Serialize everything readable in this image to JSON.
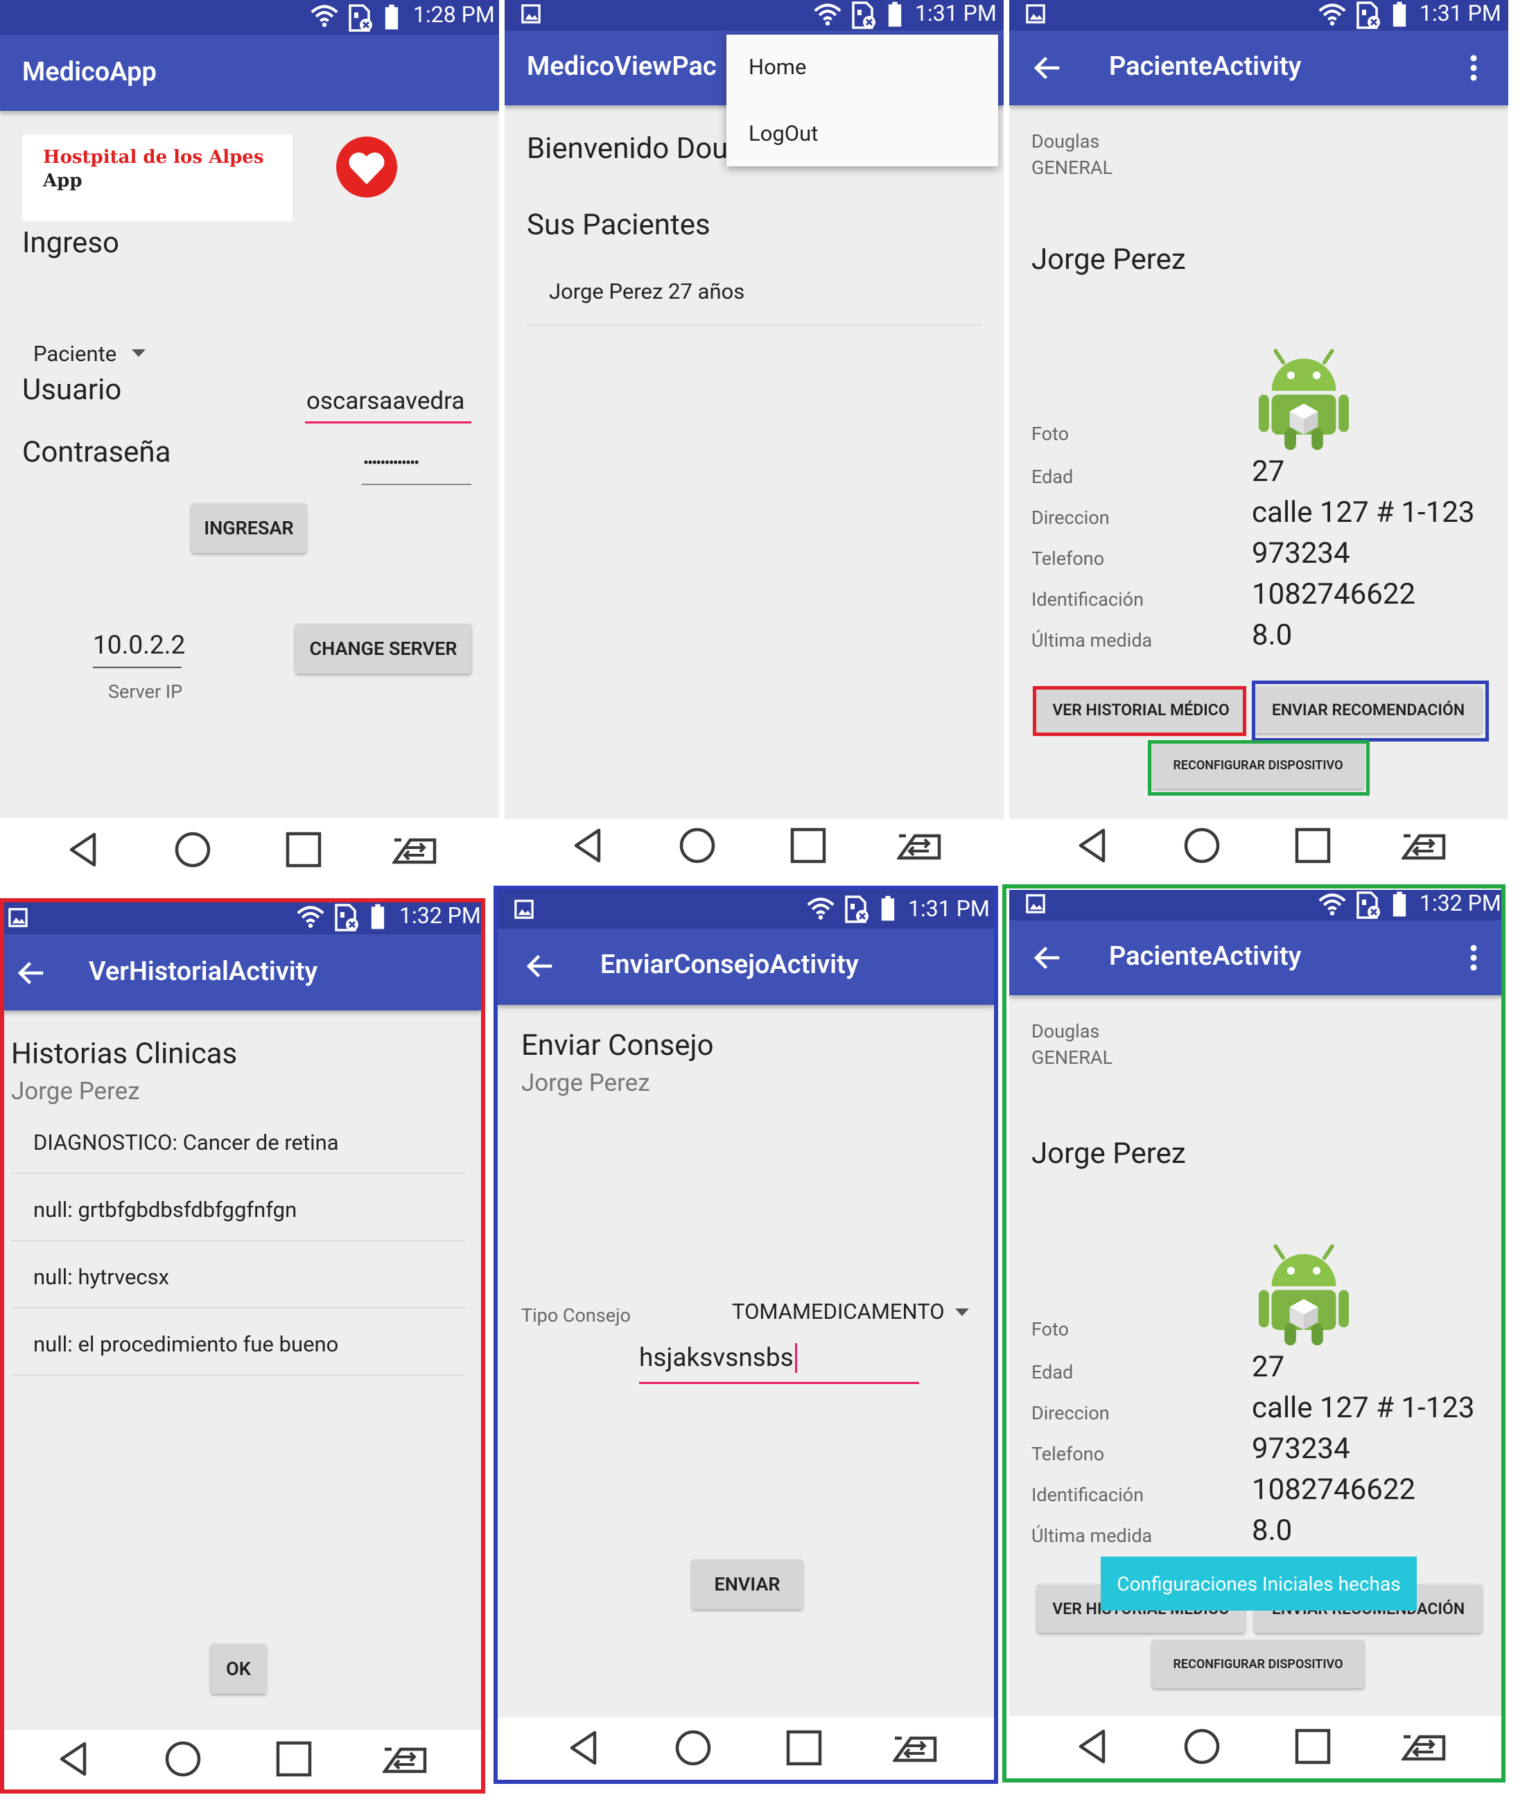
{
  "colors": {
    "primary": "#3f51b5",
    "primary_dark": "#303f9f",
    "accent": "#ff4081",
    "frame_red": "#e0202a",
    "frame_blue": "#2e3fb8",
    "frame_green": "#21a945",
    "toast": "#26c6da",
    "heart": "#e52421"
  },
  "s1": {
    "time": "1:28 PM",
    "title": "MedicoApp",
    "logo_line1": "Hostpital de los Alpes",
    "logo_line2": "App",
    "heading": "Ingreso",
    "role": "Paciente",
    "usuario_label": "Usuario",
    "usuario_value": "oscarsaavedra",
    "password_label": "Contraseña",
    "password_value": "•••••••••••••",
    "login_button": "INGRESAR",
    "server_ip": "10.0.2.2",
    "server_ip_label": "Server IP",
    "change_server_button": "CHANGE SERVER"
  },
  "s2": {
    "time": "1:31 PM",
    "title": "MedicoViewPac",
    "welcome": "Bienvenido Dou",
    "patients_heading": "Sus Pacientes",
    "patients": [
      "Jorge Perez 27 años"
    ],
    "menu": [
      "Home",
      "LogOut"
    ]
  },
  "s3": {
    "time": "1:31 PM",
    "title": "PacienteActivity",
    "doctor": "Douglas",
    "specialty": "GENERAL",
    "patient_name": "Jorge Perez",
    "labels": {
      "foto": "Foto",
      "edad": "Edad",
      "direccion": "Direccion",
      "telefono": "Telefono",
      "identificacion": "Identificación",
      "ultima": "Última medida"
    },
    "values": {
      "edad": "27",
      "direccion": "calle 127 # 1-123",
      "telefono": "973234",
      "identificacion": "1082746622",
      "ultima": "8.0"
    },
    "btn_historial": "VER HISTORIAL MÉDICO",
    "btn_recomendacion": "ENVIAR RECOMENDACIÓN",
    "btn_reconfigurar": "RECONFIGURAR DISPOSITIVO"
  },
  "s4": {
    "time": "1:32 PM",
    "title": "VerHistorialActivity",
    "heading": "Historias Clinicas",
    "patient": "Jorge Perez",
    "entries": [
      "DIAGNOSTICO: Cancer de retina",
      "null: grtbfgbdbsfdbfggfnfgn",
      "null: hytrvecsx",
      "null: el procedimiento fue bueno"
    ],
    "ok_button": "OK"
  },
  "s5": {
    "time": "1:31 PM",
    "title": "EnviarConsejoActivity",
    "heading": "Enviar Consejo",
    "patient": "Jorge Perez",
    "tipo_label": "Tipo Consejo",
    "tipo_value": "TOMAMEDICAMENTO",
    "message_value": "hsjaksvsnsbs",
    "send_button": "ENVIAR"
  },
  "s6": {
    "time": "1:32 PM",
    "title": "PacienteActivity",
    "doctor": "Douglas",
    "specialty": "GENERAL",
    "patient_name": "Jorge Perez",
    "labels": {
      "foto": "Foto",
      "edad": "Edad",
      "direccion": "Direccion",
      "telefono": "Telefono",
      "identificacion": "Identificación",
      "ultima": "Última medida"
    },
    "values": {
      "edad": "27",
      "direccion": "calle 127 # 1-123",
      "telefono": "973234",
      "identificacion": "1082746622",
      "ultima": "8.0"
    },
    "btn_historial": "VER HISTORIAL MÉDICO",
    "btn_recomendacion": "ENVIAR RECOMENDACIÓN",
    "btn_reconfigurar": "RECONFIGURAR DISPOSITIVO",
    "toast": "Configuraciones Iniciales hechas"
  }
}
